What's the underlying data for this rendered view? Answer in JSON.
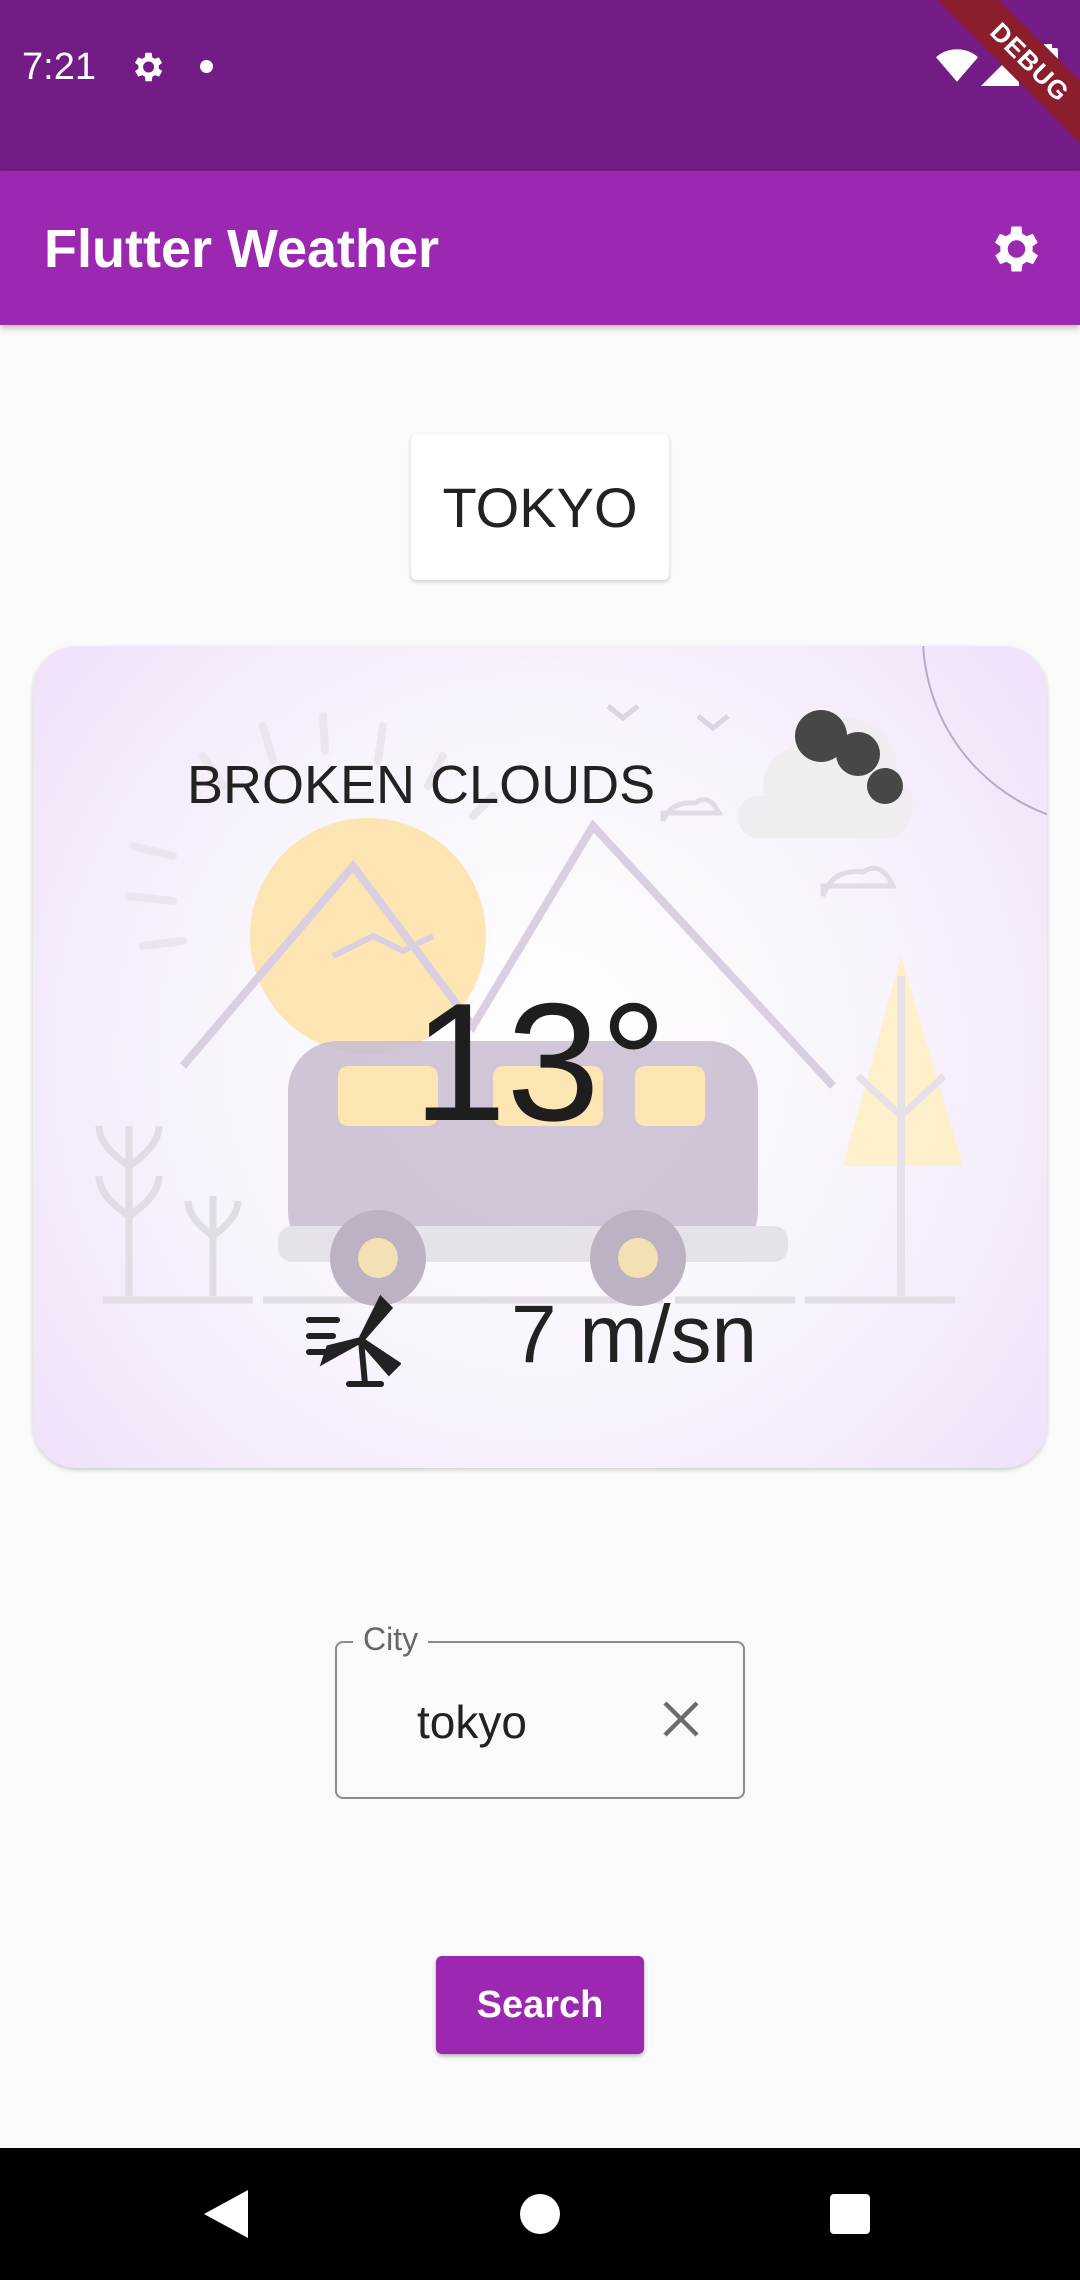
{
  "status_bar": {
    "time": "7:21",
    "debug_banner": "DEBUG"
  },
  "app_bar": {
    "title": "Flutter Weather"
  },
  "city_chip": {
    "label": "TOKYO"
  },
  "weather": {
    "condition": "BROKEN CLOUDS",
    "temperature": "13°",
    "wind_speed": "7 m/sn"
  },
  "city_input": {
    "label": "City",
    "value": "tokyo"
  },
  "search_button": {
    "label": "Search"
  },
  "colors": {
    "status_bar": "#731c85",
    "primary": "#9c27b0",
    "background": "#fafafa"
  },
  "icons": {
    "status": [
      "gear-icon",
      "dot-icon",
      "wifi-icon",
      "signal-icon",
      "battery-icon"
    ],
    "app_bar": "settings-icon",
    "wind": "wind-turbine-icon",
    "input_clear": "close-icon",
    "navigation": [
      "back-icon",
      "home-icon",
      "recents-icon"
    ]
  }
}
